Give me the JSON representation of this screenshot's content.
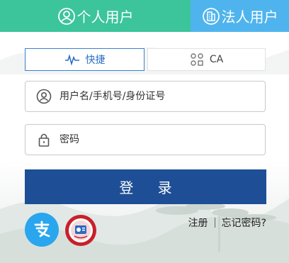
{
  "tabs": {
    "personal": {
      "label": "个人用户",
      "icon": "person-circle-icon",
      "color": "#3cc49b"
    },
    "legal": {
      "label": "法人用户",
      "icon": "building-circle-icon",
      "color": "#4fb4ed"
    }
  },
  "methods": {
    "quick": {
      "label": "快捷",
      "icon": "pulse-icon",
      "selected": true
    },
    "ca": {
      "label": "CA",
      "icon": "ca-key-icon",
      "selected": false
    }
  },
  "form": {
    "username_placeholder": "用户名/手机号/身份证号",
    "password_placeholder": "密码"
  },
  "login_button": {
    "label": "登 录",
    "color": "#1e4f96"
  },
  "footer": {
    "alipay_icon": "alipay-icon",
    "social_security_icon": "social-security-card-icon",
    "register_label": "注册",
    "forgot_label": "忘记密码?"
  }
}
